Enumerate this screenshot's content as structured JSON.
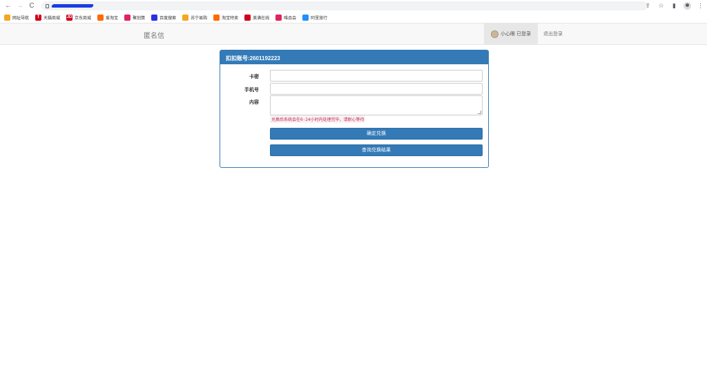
{
  "browser": {
    "nav": {
      "back": "←",
      "forward": "→",
      "reload": "C"
    },
    "right_icons": [
      "share-icon",
      "star-icon",
      "sidepanel-icon",
      "profile-icon",
      "menu-icon"
    ],
    "bookmarks": [
      {
        "label": "网址导航",
        "color": "#f5a623",
        "glyph": ""
      },
      {
        "label": "天猫商城",
        "color": "#d0021b",
        "glyph": "T"
      },
      {
        "label": "京东商城",
        "color": "#d0021b",
        "glyph": "JD"
      },
      {
        "label": "爱淘宝",
        "color": "#ff6a00",
        "glyph": ""
      },
      {
        "label": "聚划算",
        "color": "#e0245e",
        "glyph": ""
      },
      {
        "label": "百度搜索",
        "color": "#2932e1",
        "glyph": ""
      },
      {
        "label": "苏宁易购",
        "color": "#f5a623",
        "glyph": ""
      },
      {
        "label": "淘宝特卖",
        "color": "#ff6a00",
        "glyph": ""
      },
      {
        "label": "美满在线",
        "color": "#d0021b",
        "glyph": ""
      },
      {
        "label": "唯品会",
        "color": "#e0245e",
        "glyph": ""
      },
      {
        "label": "阿里旅行",
        "color": "#1e90ff",
        "glyph": ""
      }
    ]
  },
  "header": {
    "brand": "匿名信",
    "user_label": "小心眼 已登录",
    "logout": "退出登录"
  },
  "panel": {
    "title": "扣扣账号:2601192223",
    "card_label": "卡密",
    "phone_label": "手机号",
    "content_label": "内容",
    "hint": "兑换后系统会在0-24小时内处理完毕，请耐心等待",
    "confirm_button": "确定兑换",
    "query_button": "查询兑换结果"
  },
  "colors": {
    "primary": "#337ab7",
    "hint": "#c7254e"
  }
}
